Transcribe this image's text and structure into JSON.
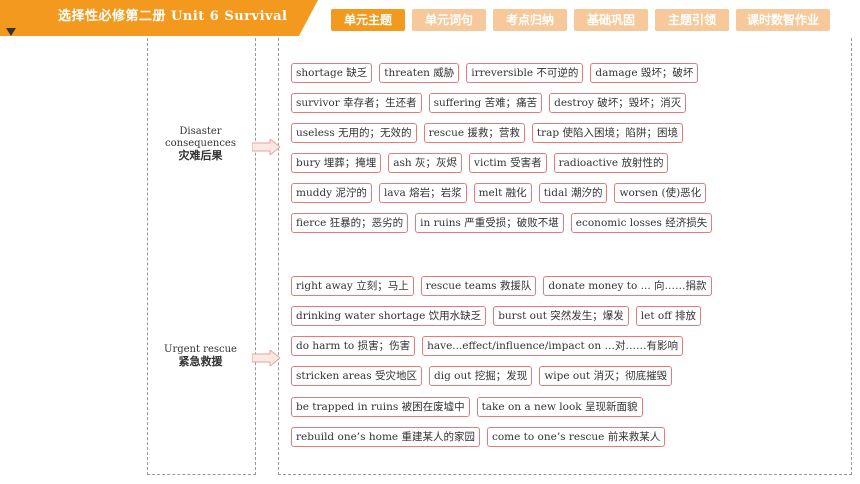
{
  "header": {
    "title": "选择性必修第二册   Unit 6   Survival",
    "tabs": [
      {
        "label": "单元主题",
        "active": true
      },
      {
        "label": "单元词句",
        "active": false
      },
      {
        "label": "考点归纳",
        "active": false
      },
      {
        "label": "基础巩固",
        "active": false
      },
      {
        "label": "主题引领",
        "active": false
      },
      {
        "label": "课时数智作业",
        "active": false
      }
    ],
    "colors": {
      "accent": "#f39a1e",
      "tab_inactive": "#f7c99a",
      "term_border": "#e77a7a"
    }
  },
  "sections": [
    {
      "label_en_1": "Disaster",
      "label_en_2": "consequences",
      "label_cn": "灾难后果",
      "rows": [
        [
          "shortage 缺乏",
          "threaten 威胁",
          "irreversible 不可逆的",
          "damage 毁坏；破坏"
        ],
        [
          "survivor 幸存者；生还者",
          "suffering 苦难；痛苦",
          "destroy 破坏；毁坏；消灭"
        ],
        [
          "useless 无用的；无效的",
          "rescue 援救；营救",
          "trap 使陷入困境；陷阱；困境"
        ],
        [
          "bury 埋葬；掩埋",
          "ash 灰；灰烬",
          "victim 受害者",
          "radioactive 放射性的"
        ],
        [
          "muddy 泥泞的",
          "lava 熔岩；岩浆",
          "melt 融化",
          "tidal 潮汐的",
          "worsen (使)恶化"
        ],
        [
          "fierce 狂暴的；恶劣的",
          "in ruins 严重受损；破败不堪",
          "economic losses 经济损失"
        ]
      ]
    },
    {
      "label_en_1": "Urgent rescue",
      "label_en_2": "",
      "label_cn": "紧急救援",
      "rows": [
        [
          "right away 立刻；马上",
          "rescue teams 救援队",
          "donate money to ... 向……捐款"
        ],
        [
          "drinking water shortage 饮用水缺乏",
          "burst out 突然发生；爆发",
          "let off 排放"
        ],
        [
          "do harm to 损害；伤害",
          "have...effect/influence/impact on …对……有影响"
        ],
        [
          "stricken areas 受灾地区",
          "dig out 挖掘；发现",
          "wipe out 消灭；彻底摧毁"
        ],
        [
          "be trapped in ruins 被困在废墟中",
          "take on a new look 呈现新面貌"
        ],
        [
          "rebuild one’s home 重建某人的家园",
          "come to one’s rescue 前来救某人"
        ]
      ]
    }
  ]
}
